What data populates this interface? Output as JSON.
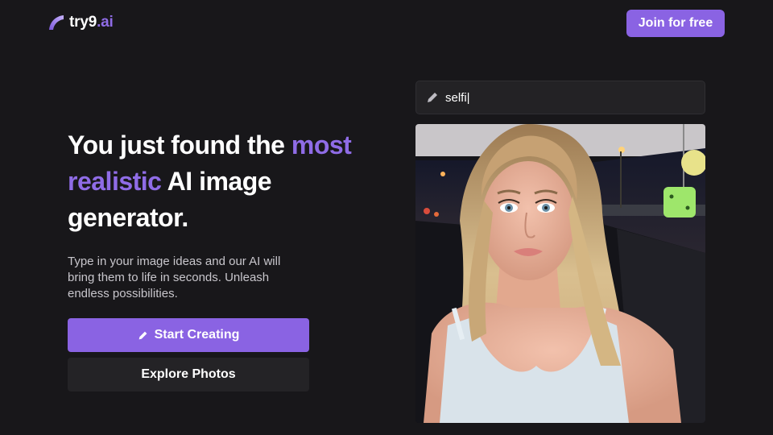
{
  "header": {
    "logo": {
      "name": "try9",
      "tld": ".ai",
      "icon": "logo-mark-icon"
    },
    "join_label": "Join for free"
  },
  "hero": {
    "headline_part1": "You just found the ",
    "headline_accent": "most realistic",
    "headline_part2": " AI image generator.",
    "subtext": "Type in your image ideas and our AI will bring them to life in seconds. Unleash endless possibilities.",
    "start_label": "Start Creating",
    "start_icon": "pencil-icon",
    "explore_label": "Explore Photos"
  },
  "generator": {
    "prompt_value": "selfi|",
    "prompt_icon": "pencil-icon",
    "image_subject": "selfie photo"
  },
  "colors": {
    "background": "#18171a",
    "accent": "#8a63e3",
    "accent_text": "#8f6ce6",
    "secondary_button": "#242326",
    "input_bg": "#232225"
  }
}
